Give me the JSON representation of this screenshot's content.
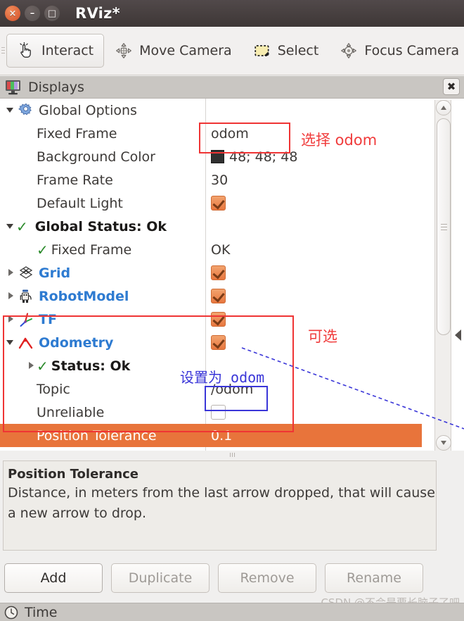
{
  "window": {
    "title": "RViz*",
    "buttons": {
      "close": "×",
      "minimize": "–",
      "maximize": "□"
    }
  },
  "toolbar": {
    "items": [
      {
        "label": "Interact",
        "icon": "hand-cursor-icon",
        "active": true
      },
      {
        "label": "Move Camera",
        "icon": "move-camera-icon",
        "active": false
      },
      {
        "label": "Select",
        "icon": "select-rect-icon",
        "active": false
      },
      {
        "label": "Focus Camera",
        "icon": "focus-camera-icon",
        "active": false
      }
    ]
  },
  "displays_panel": {
    "title": "Displays",
    "icon": "display-monitor-icon",
    "close_label": "✖",
    "rows": [
      {
        "name": "global-options",
        "label": "Global Options",
        "indent": 0,
        "twisty": "expanded",
        "icon": "gear-icon",
        "style": "plain",
        "value_type": "none",
        "value": ""
      },
      {
        "name": "fixed-frame",
        "label": "Fixed Frame",
        "indent": 1,
        "twisty": "none",
        "icon": "",
        "style": "plain",
        "value_type": "text",
        "value": "odom"
      },
      {
        "name": "background-color",
        "label": "Background Color",
        "indent": 1,
        "twisty": "none",
        "icon": "",
        "style": "plain",
        "value_type": "color",
        "value": "48; 48; 48",
        "swatch": "#303030"
      },
      {
        "name": "frame-rate",
        "label": "Frame Rate",
        "indent": 1,
        "twisty": "none",
        "icon": "",
        "style": "plain",
        "value_type": "text",
        "value": "30"
      },
      {
        "name": "default-light",
        "label": "Default Light",
        "indent": 1,
        "twisty": "none",
        "icon": "",
        "style": "plain",
        "value_type": "checkbox",
        "value": "on"
      },
      {
        "name": "global-status",
        "label": "Global Status: Ok",
        "indent": 0,
        "twisty": "expanded",
        "icon": "green-check-icon",
        "style": "bold-black",
        "value_type": "none",
        "value": ""
      },
      {
        "name": "status-fixed-frame",
        "label": "Fixed Frame",
        "indent": 1,
        "twisty": "none",
        "icon": "green-check-icon",
        "style": "plain",
        "value_type": "text",
        "value": "OK"
      },
      {
        "name": "grid",
        "label": "Grid",
        "indent": 0,
        "twisty": "collapsed",
        "icon": "grid-icon",
        "style": "blue-bold",
        "value_type": "checkbox",
        "value": "on"
      },
      {
        "name": "robot-model",
        "label": "RobotModel",
        "indent": 0,
        "twisty": "collapsed",
        "icon": "robot-icon",
        "style": "blue-bold",
        "value_type": "checkbox",
        "value": "on"
      },
      {
        "name": "tf",
        "label": "TF",
        "indent": 0,
        "twisty": "collapsed",
        "icon": "tf-axes-icon",
        "style": "blue-bold",
        "value_type": "checkbox",
        "value": "on"
      },
      {
        "name": "odometry",
        "label": "Odometry",
        "indent": 0,
        "twisty": "expanded",
        "icon": "odometry-arrow-icon",
        "style": "blue-bold",
        "value_type": "checkbox",
        "value": "on"
      },
      {
        "name": "odometry-status",
        "label": "Status: Ok",
        "indent": 1,
        "twisty": "collapsed",
        "icon": "green-check-icon",
        "style": "bold-black",
        "value_type": "none",
        "value": ""
      },
      {
        "name": "topic",
        "label": "Topic",
        "indent": 1,
        "twisty": "none",
        "icon": "",
        "style": "plain",
        "value_type": "text",
        "value": "/odom"
      },
      {
        "name": "unreliable",
        "label": "Unreliable",
        "indent": 1,
        "twisty": "none",
        "icon": "",
        "style": "plain",
        "value_type": "checkbox",
        "value": "off"
      },
      {
        "name": "position-tolerance",
        "label": "Position Tolerance",
        "indent": 1,
        "twisty": "none",
        "icon": "",
        "style": "selected",
        "value_type": "text",
        "value": "0.1"
      }
    ]
  },
  "description": {
    "title": "Position Tolerance",
    "body": "Distance, in meters from the last arrow dropped, that will cause a new arrow to drop."
  },
  "buttons": [
    {
      "name": "add-button",
      "label": "Add",
      "enabled": true
    },
    {
      "name": "duplicate-button",
      "label": "Duplicate",
      "enabled": false
    },
    {
      "name": "remove-button",
      "label": "Remove",
      "enabled": false
    },
    {
      "name": "rename-button",
      "label": "Rename",
      "enabled": false
    }
  ],
  "time_panel": {
    "label": "Time",
    "icon": "clock-icon"
  },
  "annotations": {
    "select_odom": "选择 odom",
    "optional": "可选",
    "set_as_odom": "设置为 odom",
    "colors": {
      "red": "#ef3434",
      "blue": "#3a36d8"
    }
  },
  "watermark": "CSDN @不会是要长脑子了吧"
}
